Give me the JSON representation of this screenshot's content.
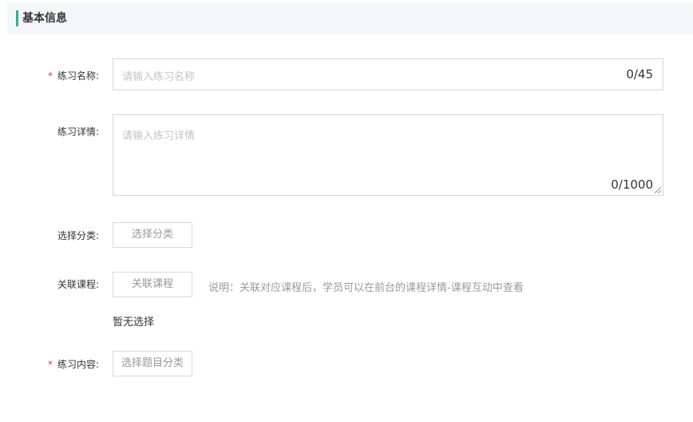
{
  "section": {
    "title": "基本信息",
    "accent_color": "#2bb48f"
  },
  "form": {
    "name": {
      "label": "练习名称:",
      "required_mark": "*",
      "placeholder": "请输入练习名称",
      "counter": "0/45"
    },
    "details": {
      "label": "练习详情:",
      "placeholder": "请输入练习详情",
      "counter": "0/1000"
    },
    "category": {
      "label": "选择分类:",
      "button_label": "选择分类"
    },
    "course": {
      "label": "关联课程:",
      "button_label": "关联课程",
      "hint": "说明：关联对应课程后，学员可以在前台的课程详情-课程互动中查看",
      "empty_text": "暂无选择"
    },
    "content": {
      "label": "练习内容:",
      "required_mark": "*",
      "button_label": "选择题目分类"
    }
  }
}
